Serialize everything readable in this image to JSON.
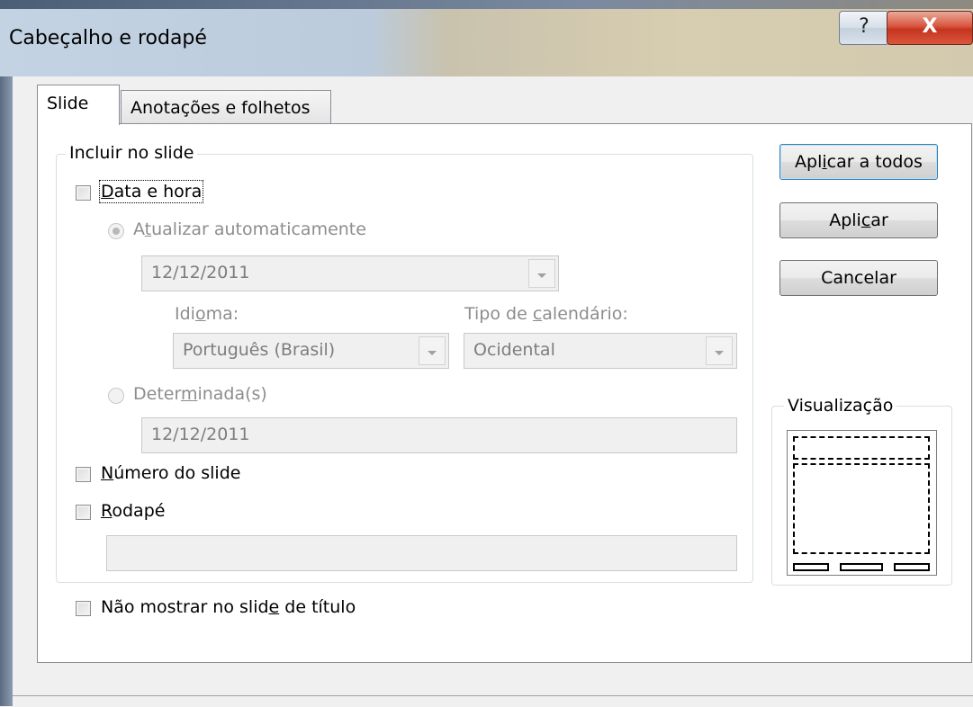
{
  "window": {
    "title": "Cabeçalho e rodapé",
    "help_glyph": "?",
    "close_glyph": "X"
  },
  "tabs": [
    {
      "label": "Slide",
      "selected": true
    },
    {
      "label": "Anotações e folhetos",
      "selected": false
    }
  ],
  "include_group": {
    "label": "Incluir no slide",
    "date_time": {
      "label_pre": "",
      "label_ul": "D",
      "label_post": "ata e hora",
      "checked": false
    },
    "auto_update": {
      "label_pre": "A",
      "label_ul": "t",
      "label_post": "ualizar automaticamente",
      "selected": true
    },
    "auto_date_value": "12/12/2011",
    "language": {
      "label_pre": "Idi",
      "label_ul": "o",
      "label_post": "ma:",
      "value": "Português (Brasil)"
    },
    "calendar": {
      "label_pre": "Tipo de ",
      "label_ul": "c",
      "label_post": "alendário:",
      "value": "Ocidental"
    },
    "fixed": {
      "label_pre": "Deter",
      "label_ul": "m",
      "label_post": "inada(s)",
      "selected": false
    },
    "fixed_value": "12/12/2011",
    "slide_number": {
      "label_pre": "",
      "label_ul": "N",
      "label_post": "úmero do slide",
      "checked": false
    },
    "footer": {
      "label_pre": "",
      "label_ul": "R",
      "label_post": "odapé",
      "checked": false,
      "value": ""
    }
  },
  "dont_show_title": {
    "label_pre": "Não mostrar no slid",
    "label_ul": "e",
    "label_post": " de título",
    "checked": false
  },
  "buttons": {
    "apply_all": {
      "pre": "Apl",
      "ul": "i",
      "post": "car a todos"
    },
    "apply": {
      "pre": "Apli",
      "ul": "c",
      "post": "ar"
    },
    "cancel": "Cancelar"
  },
  "preview": {
    "label": "Visualização"
  }
}
